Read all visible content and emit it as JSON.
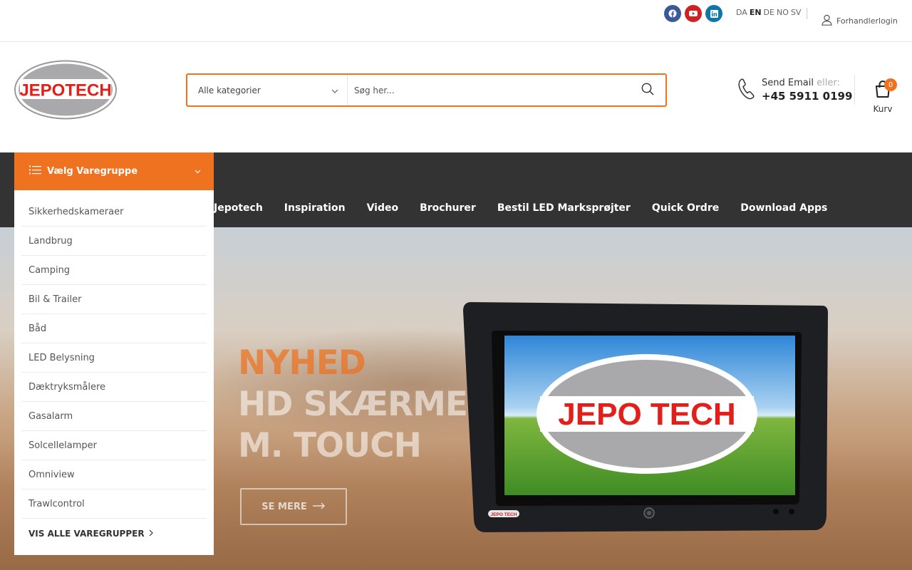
{
  "topbar": {
    "social": [
      {
        "name": "facebook-icon",
        "color": "#3b5998"
      },
      {
        "name": "youtube-icon",
        "color": "#d02020"
      },
      {
        "name": "linkedin-icon",
        "color": "#0e76a8"
      }
    ],
    "languages": [
      "DA",
      "EN",
      "DE",
      "NO",
      "SV"
    ],
    "active_language": "EN",
    "login_label": "Forhandlerlogin"
  },
  "header": {
    "logo_text": "JEPOTECH",
    "search": {
      "category_label": "Alle kategorier",
      "placeholder": "Søg her..."
    },
    "contact": {
      "email_label": "Send Email",
      "or_label": "eller:",
      "phone": "+45 5911 0199"
    },
    "cart": {
      "count": "0",
      "label": "Kurv"
    }
  },
  "nav": {
    "items": [
      "Jepotech",
      "Inspiration",
      "Video",
      "Brochurer",
      "Bestil LED Marksprøjter",
      "Quick Ordre",
      "Download Apps"
    ]
  },
  "categories": {
    "title": "Vælg Varegruppe",
    "items": [
      "Sikkerhedskameraer",
      "Landbrug",
      "Camping",
      "Bil & Trailer",
      "Båd",
      "LED Belysning",
      "Dæktryksmålere",
      "Gasalarm",
      "Solcellelamper",
      "Omniview",
      "Trawlcontrol"
    ],
    "view_all": "VIS ALLE VAREGRUPPER"
  },
  "hero": {
    "line1": "NYHED",
    "line2": "HD SKÆRME",
    "line3": "M. TOUCH",
    "cta": "SE MERE",
    "screen_logo": "JEPO TECH",
    "bezel_logo": "JEPO TECH"
  },
  "colors": {
    "accent": "#ee7220",
    "nav_bg": "#333333"
  }
}
